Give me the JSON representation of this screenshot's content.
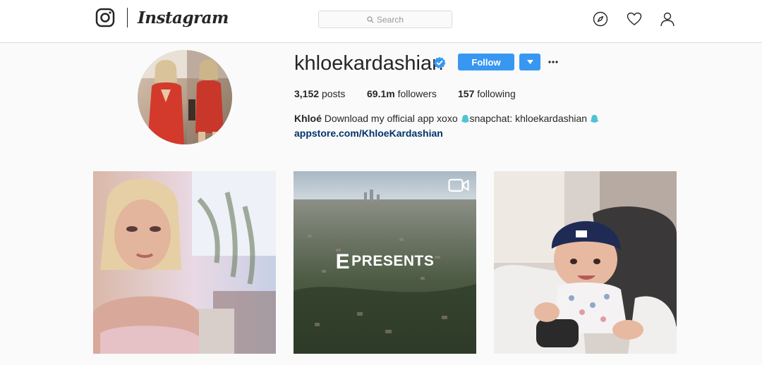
{
  "nav": {
    "wordmark": "Instagram",
    "search_placeholder": "Search"
  },
  "profile": {
    "username": "khloekardashian",
    "follow_label": "Follow",
    "more_label": "···",
    "stats": {
      "posts_count": "3,152",
      "posts_label": "posts",
      "followers_count": "69.1m",
      "followers_label": "followers",
      "following_count": "157",
      "following_label": "following"
    },
    "bio": {
      "name": "Khloé",
      "text_1": "Download my official app xoxo",
      "text_2": "snapchat: khloekardashian",
      "link": "appstore.com/KhloeKardashian"
    }
  },
  "posts": [
    {
      "kind": "photo"
    },
    {
      "kind": "video",
      "overlay_mark": "E",
      "overlay_text": "PRESENTS"
    },
    {
      "kind": "photo"
    }
  ],
  "colors": {
    "accent": "#3897f0",
    "link": "#003569",
    "snapchat_ghost": "#4fc3d1",
    "verified": "#3897f0"
  },
  "icons": [
    "instagram-glyph-icon",
    "search-icon",
    "explore-icon",
    "heart-icon",
    "profile-icon",
    "verified-badge-icon",
    "chevron-down-icon",
    "more-icon",
    "snapchat-ghost-icon",
    "video-icon"
  ]
}
